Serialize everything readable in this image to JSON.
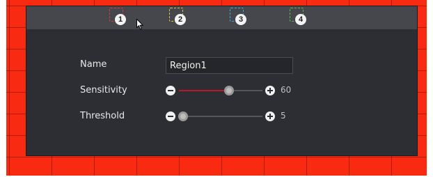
{
  "regions": [
    {
      "number": "1",
      "color": "#e23a3a",
      "selected": true
    },
    {
      "number": "2",
      "color": "#e3c63a"
    },
    {
      "number": "3",
      "color": "#2fb2d6"
    },
    {
      "number": "4",
      "color": "#4cc24a"
    }
  ],
  "form": {
    "name": {
      "label": "Name",
      "value": "Region1"
    },
    "sensitivity": {
      "label": "Sensitivity",
      "value": "60",
      "fraction": 0.6
    },
    "threshold": {
      "label": "Threshold",
      "value": "5",
      "fraction": 0.05
    }
  },
  "colors": {
    "grid": "#f82a12",
    "panel": "#2d2e33",
    "slider_fill": "#b8182a"
  },
  "icons": {
    "decrement": "minus-circle-icon",
    "increment": "plus-circle-icon",
    "cursor": "mouse-pointer-icon"
  }
}
